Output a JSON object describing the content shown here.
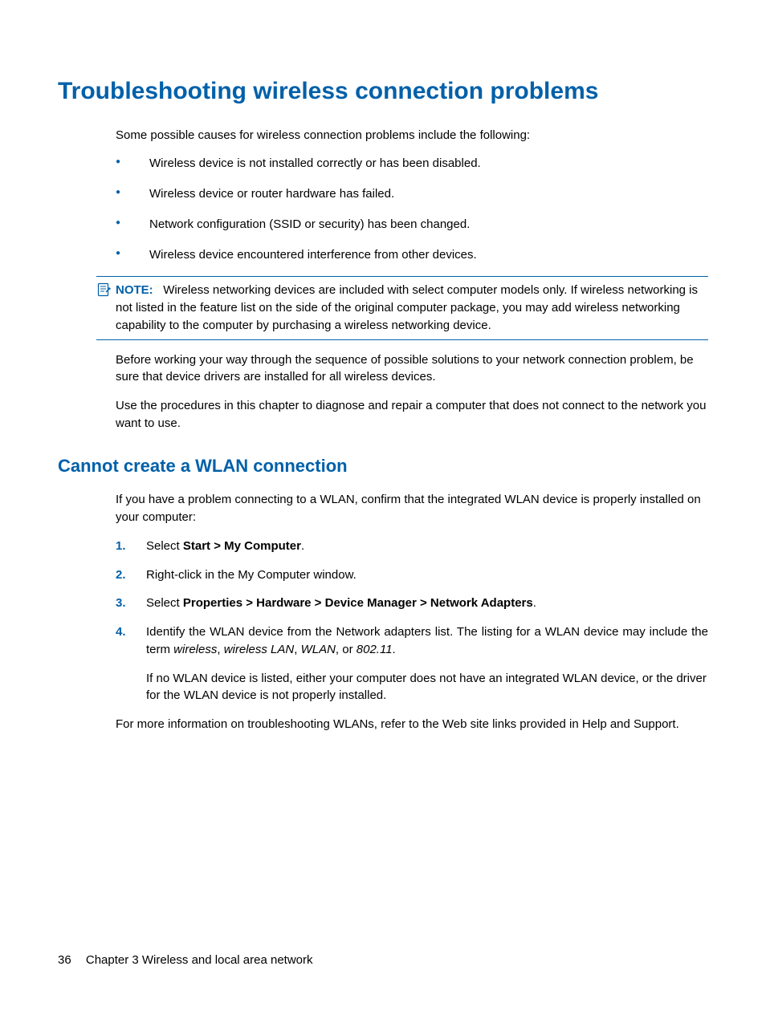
{
  "title": "Troubleshooting wireless connection problems",
  "intro": "Some possible causes for wireless connection problems include the following:",
  "bullets": [
    "Wireless device is not installed correctly or has been disabled.",
    "Wireless device or router hardware has failed.",
    "Network configuration (SSID or security) has been changed.",
    "Wireless device encountered interference from other devices."
  ],
  "note": {
    "label": "NOTE:",
    "text": "Wireless networking devices are included with select computer models only. If wireless networking is not listed in the feature list on the side of the original computer package, you may add wireless networking capability to the computer by purchasing a wireless networking device."
  },
  "para2": "Before working your way through the sequence of possible solutions to your network connection problem, be sure that device drivers are installed for all wireless devices.",
  "para3": "Use the procedures in this chapter to diagnose and repair a computer that does not connect to the network you want to use.",
  "h2": "Cannot create a WLAN connection",
  "h2_intro": "If you have a problem connecting to a WLAN, confirm that the integrated WLAN device is properly installed on your computer:",
  "steps": {
    "s1_pre": "Select ",
    "s1_bold": "Start > My Computer",
    "s1_post": ".",
    "s2": "Right-click in the My Computer window.",
    "s3_pre": "Select ",
    "s3_bold": "Properties > Hardware > Device Manager > Network Adapters",
    "s3_post": ".",
    "s4_a_pre": "Identify the WLAN device from the Network adapters list. The listing for a WLAN device may include the term ",
    "s4_a_i1": "wireless",
    "s4_a_c1": ", ",
    "s4_a_i2": "wireless LAN",
    "s4_a_c2": ", ",
    "s4_a_i3": "WLAN",
    "s4_a_c3": ", or ",
    "s4_a_i4": "802.11",
    "s4_a_post": ".",
    "s4_b": "If no WLAN device is listed, either your computer does not have an integrated WLAN device, or the driver for the WLAN device is not properly installed."
  },
  "closing": "For more information on troubleshooting WLANs, refer to the Web site links provided in Help and Support.",
  "footer": {
    "page": "36",
    "chapter": "Chapter 3   Wireless and local area network"
  }
}
